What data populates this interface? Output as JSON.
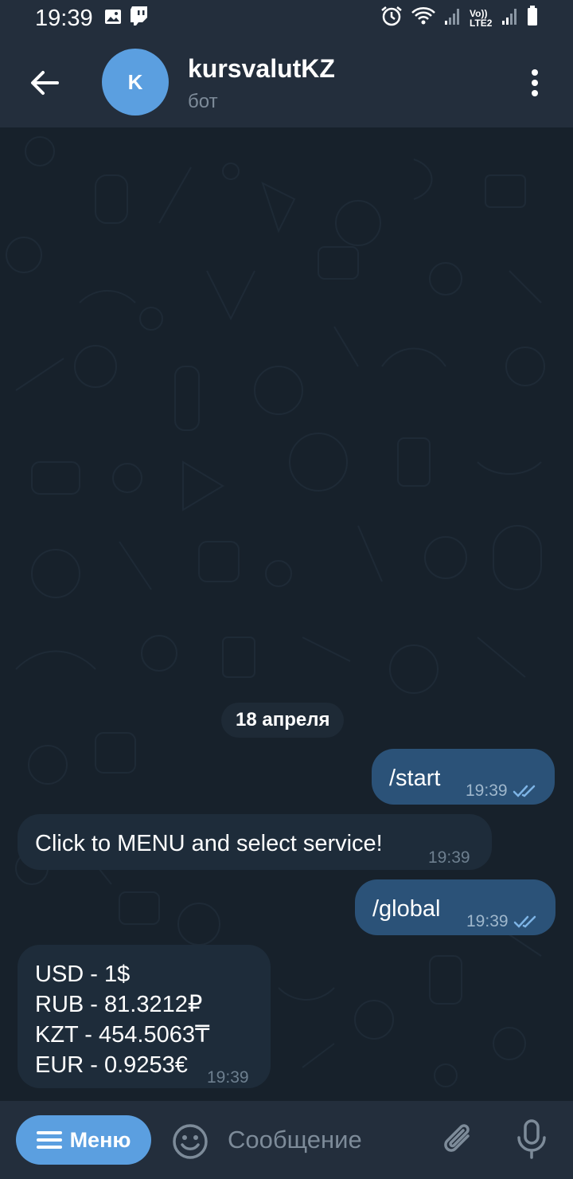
{
  "status_bar": {
    "time": "19:39",
    "left_icons": [
      "image-icon",
      "twitch-icon"
    ],
    "right_icons": [
      "alarm-icon",
      "wifi-icon",
      "signal-icon",
      "volte-icon",
      "signal-icon",
      "battery-icon"
    ],
    "volte_label": "Vo)) LTE2"
  },
  "header": {
    "title": "kursvalutKZ",
    "subtitle": "бот",
    "avatar_letter": "K",
    "avatar_color": "#5b9fe0"
  },
  "chat": {
    "date": "18 апреля",
    "messages": [
      {
        "direction": "out",
        "text": "/start",
        "time": "19:39",
        "status": "read"
      },
      {
        "direction": "in",
        "text": "Click to MENU and select service!",
        "time": "19:39"
      },
      {
        "direction": "out",
        "text": "/global",
        "time": "19:39",
        "status": "read"
      },
      {
        "direction": "in",
        "lines": [
          "USD - 1$",
          "RUB - 81.3212₽",
          "KZT - 454.5063₸",
          "EUR - 0.9253€"
        ],
        "time": "19:39"
      }
    ]
  },
  "input_bar": {
    "menu_label": "Меню",
    "placeholder": "Сообщение"
  },
  "colors": {
    "accent": "#5b9fe0",
    "outgoing_bubble": "#2b5278",
    "incoming_bubble": "#1e2c3a",
    "header_bg": "#232e3c",
    "chat_bg": "#17212b"
  }
}
